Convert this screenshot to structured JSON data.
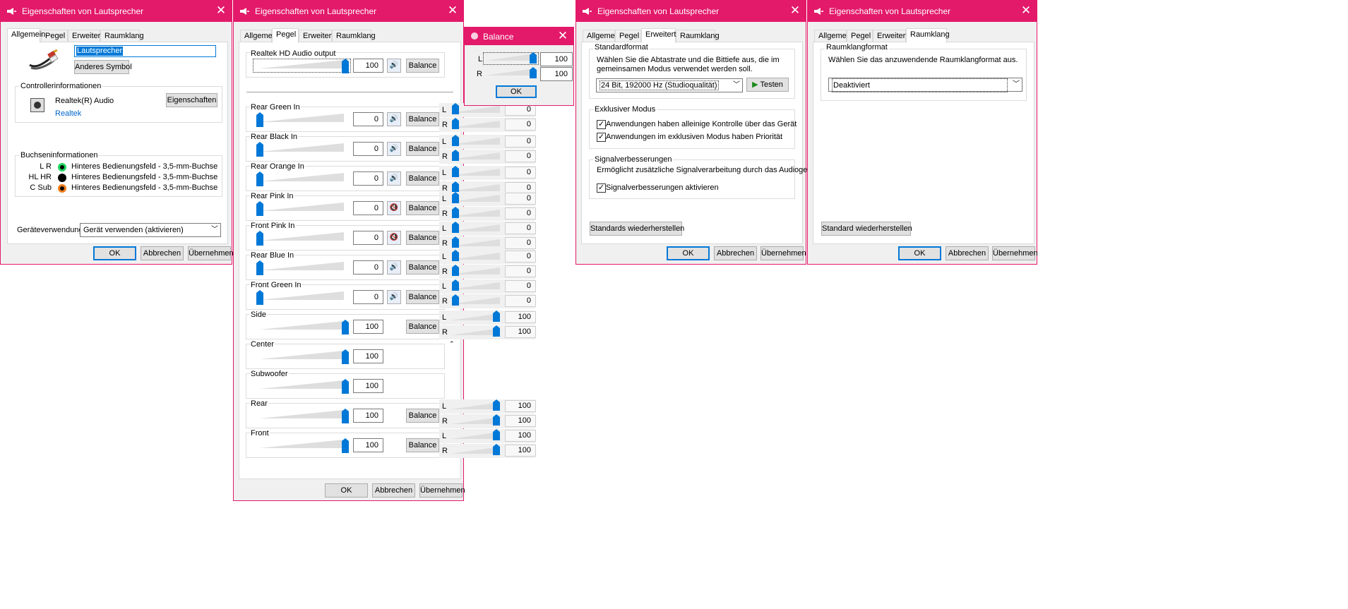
{
  "window_title": "Eigenschaften von Lautsprecher",
  "tabs": {
    "allgemein": "Allgemein",
    "pegel": "Pegel",
    "erweitert": "Erweitert",
    "raumklang": "Raumklang"
  },
  "dialog_buttons": {
    "ok": "OK",
    "cancel": "Abbrechen",
    "apply": "Übernehmen"
  },
  "general": {
    "device_name": "Lautsprecher",
    "change_icon": "Anderes Symbol",
    "controller_group": "Controllerinformationen",
    "controller_name": "Realtek(R) Audio",
    "controller_link": "Realtek",
    "properties_button": "Eigenschaften",
    "jack_group": "Buchseninformationen",
    "jacks": [
      {
        "label": "L R",
        "location": "Hinteres Bedienungsfeld - 3,5-mm-Buchse",
        "color": "#1ed760"
      },
      {
        "label": "HL HR",
        "location": "Hinteres Bedienungsfeld - 3,5-mm-Buchse",
        "color": "#000000"
      },
      {
        "label": "C Sub",
        "location": "Hinteres Bedienungsfeld - 3,5-mm-Buchse",
        "color": "#f07c1a"
      }
    ],
    "usage_label": "Geräteverwendung:",
    "usage_value": "Gerät verwenden (aktivieren)"
  },
  "levels": {
    "balance_label": "Balance",
    "output": {
      "name": "Realtek HD Audio output",
      "value": "100"
    },
    "channels": [
      {
        "name": "Rear Green In",
        "value": "0",
        "muted": false,
        "balance": true
      },
      {
        "name": "Rear Black In",
        "value": "0",
        "muted": false,
        "balance": true
      },
      {
        "name": "Rear Orange In",
        "value": "0",
        "muted": false,
        "balance": true
      },
      {
        "name": "Rear Pink In",
        "value": "0",
        "muted": true,
        "balance": true
      },
      {
        "name": "Front Pink In",
        "value": "0",
        "muted": true,
        "balance": true
      },
      {
        "name": "Rear Blue In",
        "value": "0",
        "muted": false,
        "balance": true
      },
      {
        "name": "Front Green In",
        "value": "0",
        "muted": false,
        "balance": true
      },
      {
        "name": "Side",
        "value": "100",
        "muted": null,
        "balance": true
      },
      {
        "name": "Center",
        "value": "100",
        "muted": null,
        "balance": false
      },
      {
        "name": "Subwoofer",
        "value": "100",
        "muted": null,
        "balance": false
      },
      {
        "name": "Rear",
        "value": "100",
        "muted": null,
        "balance": true
      },
      {
        "name": "Front",
        "value": "100",
        "muted": null,
        "balance": true
      }
    ]
  },
  "balance_dialog": {
    "title": "Balance",
    "left_label": "L",
    "left_value": "100",
    "right_label": "R",
    "right_value": "100",
    "ok": "OK"
  },
  "balance_ghost_rows": [
    {
      "label": "L",
      "value": "0"
    },
    {
      "label": "R",
      "value": "0"
    },
    {
      "label": "L",
      "value": "0"
    },
    {
      "label": "R",
      "value": "0"
    },
    {
      "label": "L",
      "value": "0"
    },
    {
      "label": "R",
      "value": "0"
    },
    {
      "label": "L",
      "value": "0"
    },
    {
      "label": "R",
      "value": "0"
    },
    {
      "label": "L",
      "value": "0"
    },
    {
      "label": "R",
      "value": "0"
    },
    {
      "label": "L",
      "value": "0"
    },
    {
      "label": "R",
      "value": "0"
    },
    {
      "label": "L",
      "value": "0"
    },
    {
      "label": "R",
      "value": "0"
    },
    {
      "label": "L",
      "value": "100"
    },
    {
      "label": "R",
      "value": "100"
    },
    {
      "label": "L",
      "value": "100"
    },
    {
      "label": "R",
      "value": "100"
    },
    {
      "label": "L",
      "value": "100"
    },
    {
      "label": "R",
      "value": "100"
    }
  ],
  "advanced": {
    "format_group": "Standardformat",
    "format_desc_1": "Wählen Sie die Abtastrate und die Bittiefe aus, die im",
    "format_desc_2": "gemeinsamen Modus verwendet werden soll.",
    "format_value": "24 Bit, 192000 Hz (Studioqualität)",
    "test_button": "Testen",
    "exclusive_group": "Exklusiver Modus",
    "exclusive_1": "Anwendungen haben alleinige Kontrolle über das Gerät",
    "exclusive_2": "Anwendungen im exklusiven Modus haben Priorität",
    "enh_group": "Signalverbesserungen",
    "enh_desc": "Ermöglicht zusätzliche Signalverarbeitung durch das Audiogerät",
    "enh_check": "Signalverbesserungen aktivieren",
    "restore": "Standards wiederherstellen"
  },
  "spatial": {
    "group": "Raumklangformat",
    "desc": "Wählen Sie das anzuwendende Raumklangformat aus.",
    "value": "Deaktiviert",
    "restore": "Standard wiederherstellen"
  },
  "colors": {
    "accent": "#e3196a",
    "slider": "#0078d7"
  }
}
